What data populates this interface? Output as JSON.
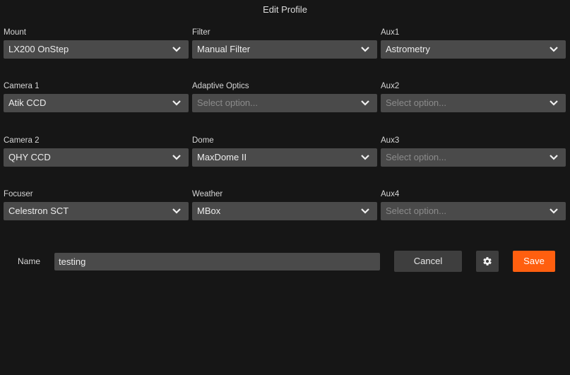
{
  "title": "Edit Profile",
  "colors": {
    "background": "#161616",
    "field": "#4a4a4a",
    "button": "#3e3e3e",
    "accent": "#ff5f0f",
    "placeholder": "#8b8b8b"
  },
  "columns": [
    {
      "fields": [
        {
          "label": "Mount",
          "value": "LX200 OnStep",
          "placeholder": false
        },
        {
          "label": "Camera 1",
          "value": "Atik CCD",
          "placeholder": false
        },
        {
          "label": "Camera 2",
          "value": "QHY CCD",
          "placeholder": false
        },
        {
          "label": "Focuser",
          "value": "Celestron SCT",
          "placeholder": false
        }
      ]
    },
    {
      "fields": [
        {
          "label": "Filter",
          "value": "Manual Filter",
          "placeholder": false
        },
        {
          "label": "Adaptive Optics",
          "value": "Select option...",
          "placeholder": true
        },
        {
          "label": "Dome",
          "value": "MaxDome II",
          "placeholder": false
        },
        {
          "label": "Weather",
          "value": "MBox",
          "placeholder": false
        }
      ]
    },
    {
      "fields": [
        {
          "label": "Aux1",
          "value": "Astrometry",
          "placeholder": false
        },
        {
          "label": "Aux2",
          "value": "Select option...",
          "placeholder": true
        },
        {
          "label": "Aux3",
          "value": "Select option...",
          "placeholder": true
        },
        {
          "label": "Aux4",
          "value": "Select option...",
          "placeholder": true
        }
      ]
    }
  ],
  "name_field": {
    "label": "Name",
    "value": "testing"
  },
  "buttons": {
    "cancel": "Cancel",
    "settings_icon": "gear-icon",
    "save": "Save"
  }
}
